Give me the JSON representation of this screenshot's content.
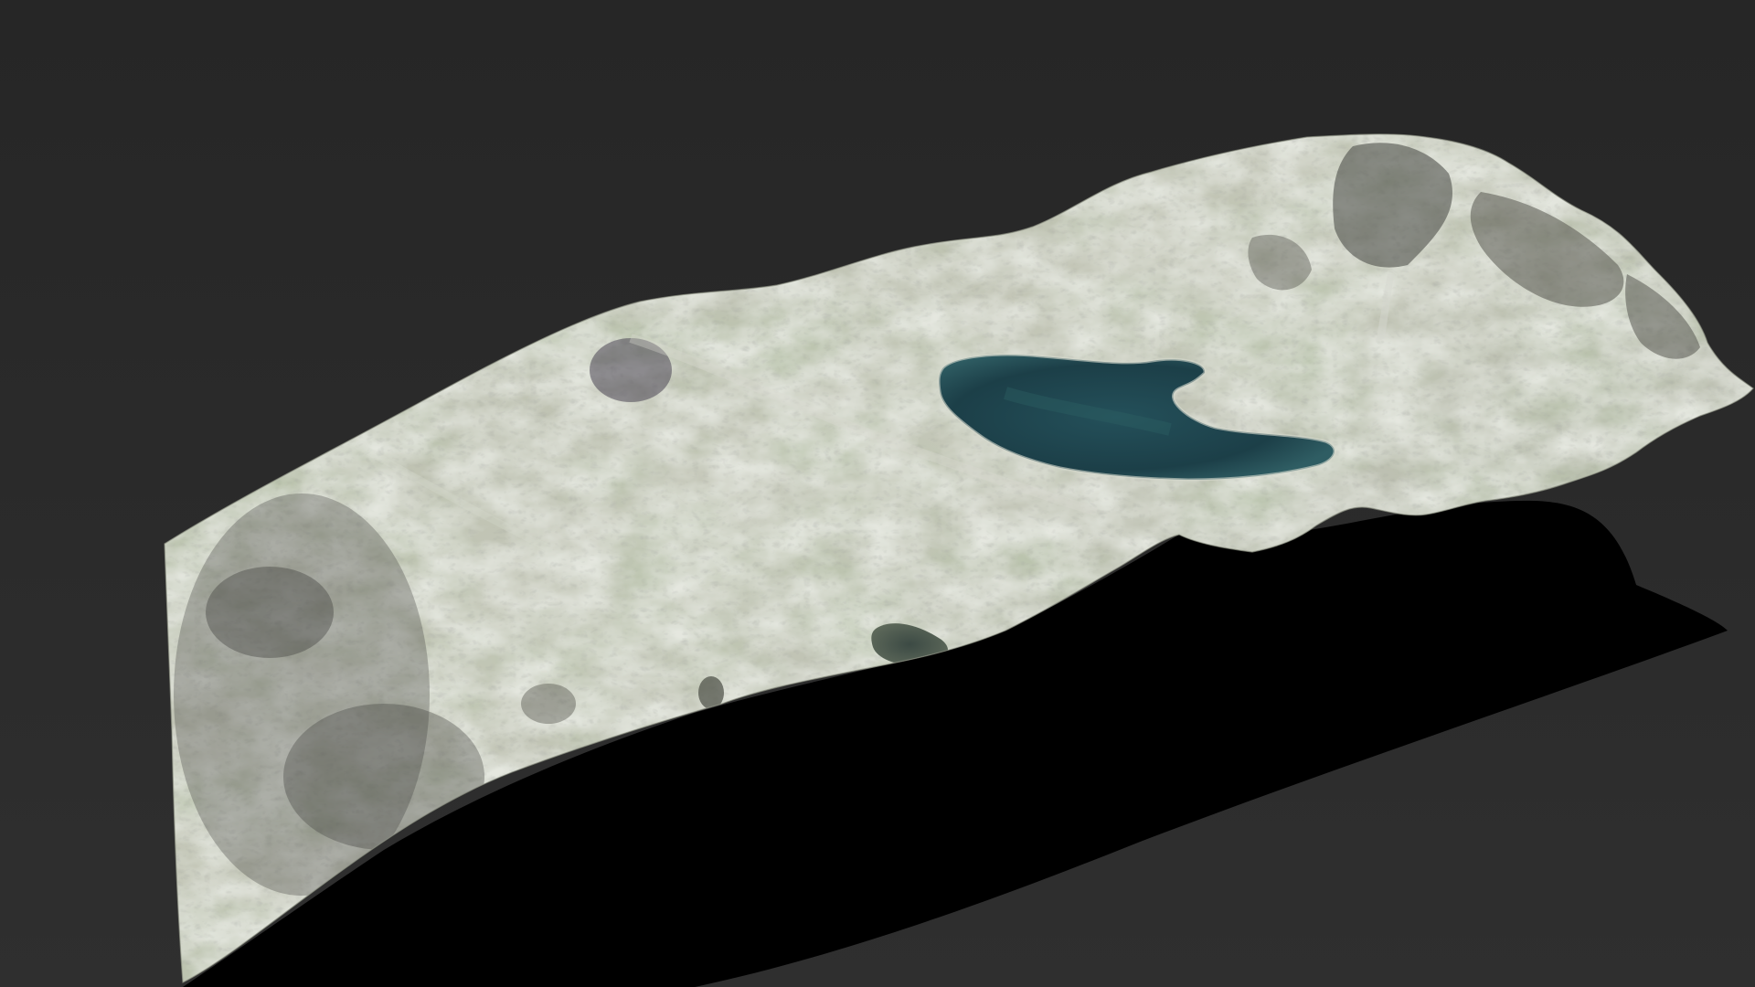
{
  "scene": {
    "background_color": "#2b2b2b",
    "shadow_color": "#000000",
    "terrain_colors": {
      "rock_light": "#c9ccbf",
      "rock_mid": "#aab0a0",
      "grass": "#8c9a6e",
      "rock_dark": "#5e5f5a",
      "lake_deep": "#1c3f48",
      "lake_edge": "#3c6a6e"
    },
    "elements": [
      "terrain-model",
      "main-lake",
      "small-pond",
      "cast-shadow",
      "rocky-peak"
    ]
  }
}
